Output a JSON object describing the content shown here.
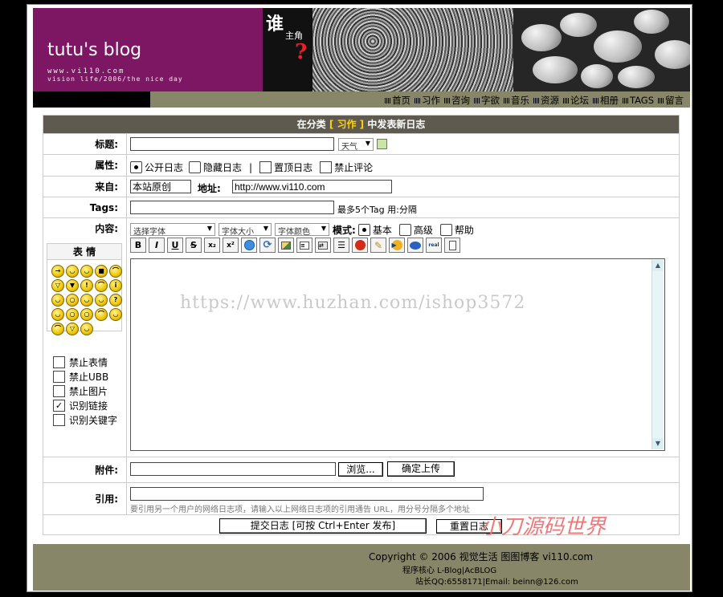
{
  "banner": {
    "blog_title": "tutu's blog",
    "url_line": "www.vi110.com",
    "tagline": "vision life/2006/the nice day",
    "who_char": "谁",
    "role": "主角",
    "question": "?"
  },
  "nav": [
    {
      "label": "首页"
    },
    {
      "label": "习作"
    },
    {
      "label": "咨询"
    },
    {
      "label": "字欲"
    },
    {
      "label": "音乐"
    },
    {
      "label": "资源"
    },
    {
      "label": "论坛"
    },
    {
      "label": "相册"
    },
    {
      "label": "TAGS"
    },
    {
      "label": "留言"
    }
  ],
  "form": {
    "header_prefix": "在分类",
    "category": "[ 习作 ]",
    "header_suffix": "中发表新日志",
    "title_label": "标题:",
    "weather_select": "天气",
    "attr_label": "属性:",
    "attr_public": "公开日志",
    "attr_hidden": "隐藏日志",
    "attr_sep": "|",
    "attr_top": "置顶日志",
    "attr_nocomment": "禁止评论",
    "from_label": "来自:",
    "from_value": "本站原创",
    "addr_label": "地址:",
    "addr_value": "http://www.vi110.com",
    "tags_label": "Tags:",
    "tags_hint": "最多5个Tag 用:分隔",
    "content_label": "内容:",
    "font_select": "选择字体",
    "size_select": "字体大小",
    "color_select": "字体颜色",
    "mode_label": "模式:",
    "mode_basic": "基本",
    "mode_advanced": "高级",
    "mode_help": "帮助",
    "faces_title": "表 情",
    "options": [
      {
        "label": "禁止表情",
        "checked": ""
      },
      {
        "label": "禁止UBB",
        "checked": ""
      },
      {
        "label": "禁止图片",
        "checked": ""
      },
      {
        "label": "识别链接",
        "checked": "✓"
      },
      {
        "label": "识别关键字",
        "checked": ""
      }
    ],
    "attach_label": "附件:",
    "browse_button": "浏览...",
    "upload_button": "确定上传",
    "quote_label": "引用:",
    "quote_hint": "要引用另一个用户的网络日志项，请输入以上网络日志项的引用通告 URL，用分号分隔多个地址",
    "submit_button": "提交日志 [可按 Ctrl+Enter 发布]",
    "reset_button": "重置日志"
  },
  "toolbar": {
    "bold": "B",
    "italic": "I",
    "underline": "U",
    "strike": "S",
    "sub": "x₂",
    "sup": "x²"
  },
  "watermark": "https://www.huzhan.com/ishop3572",
  "stamp": "小刀源码世界",
  "footer": {
    "copyright": "Copyright © 2006 视觉生活 图图博客  vi110.com",
    "powered": "程序核心 L-Blog|AcBLOG",
    "contact": "站长QQ:6558171|Email: beinn@126.com"
  }
}
